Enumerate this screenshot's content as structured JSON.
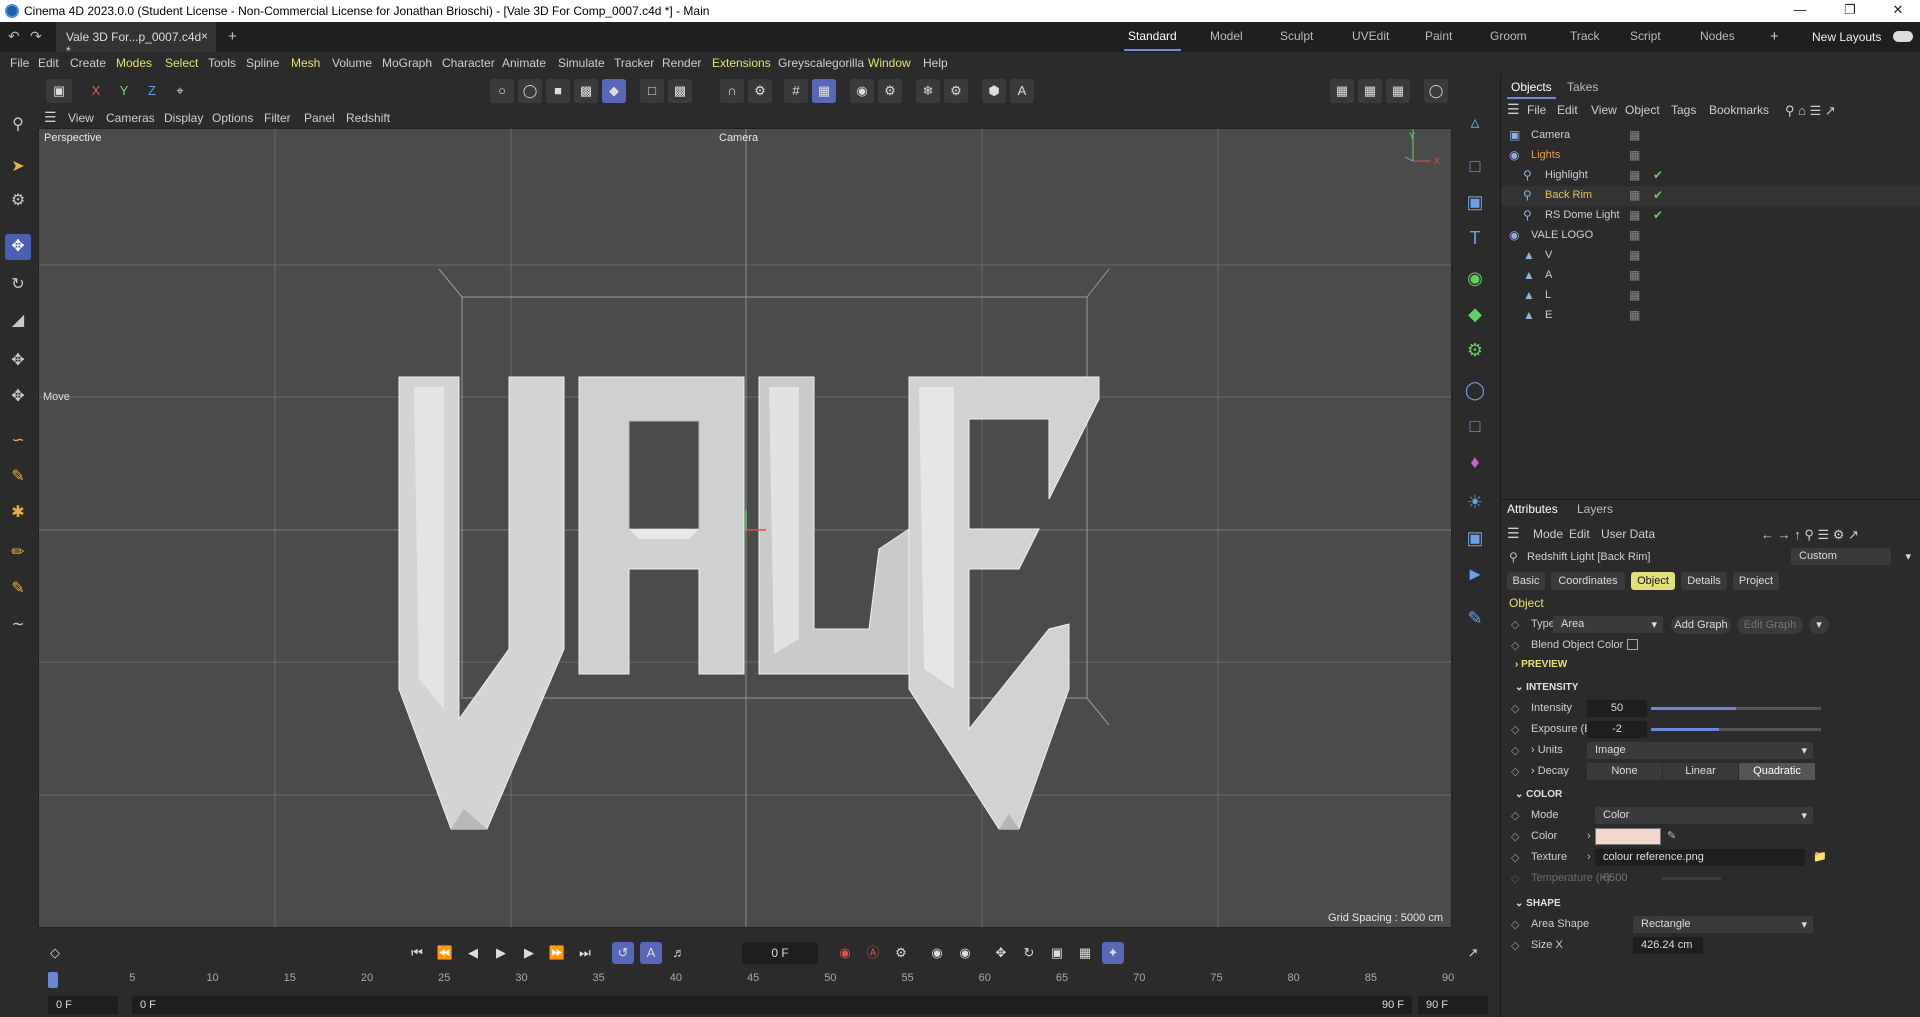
{
  "window": {
    "title": "Cinema 4D 2023.0.0 (Student License - Non-Commercial License for Jonathan Brioschi) - [Vale 3D For Comp_0007.c4d *] - Main"
  },
  "doc_tab": {
    "label": "Vale 3D For...p_0007.c4d *",
    "close": "×",
    "add": "+"
  },
  "layouts": [
    "Standard",
    "Model",
    "Sculpt",
    "UVEdit",
    "Paint",
    "Groom",
    "Track",
    "Script",
    "Nodes"
  ],
  "new_layouts": "New Layouts",
  "menu": [
    "File",
    "Edit",
    "Create",
    "Modes",
    "Select",
    "Tools",
    "Spline",
    "Mesh",
    "Volume",
    "MoGraph",
    "Character",
    "Animate",
    "Simulate",
    "Tracker",
    "Render",
    "Extensions",
    "Greyscalegorilla",
    "Window",
    "Help"
  ],
  "axes": [
    "X",
    "Y",
    "Z"
  ],
  "viewport_menu": [
    "View",
    "Cameras",
    "Display",
    "Options",
    "Filter",
    "Panel",
    "Redshift"
  ],
  "viewport": {
    "projection": "Perspective",
    "camera": "Camera",
    "grid_spacing": "Grid Spacing : 5000 cm",
    "tool_hint": "Move",
    "logo_text": "VALE"
  },
  "timeline": {
    "frame": "0 F",
    "start": "0 F",
    "start2": "0 F",
    "end": "90 F",
    "end2": "90 F",
    "ticks": [
      "0",
      "5",
      "10",
      "15",
      "20",
      "25",
      "30",
      "35",
      "40",
      "45",
      "50",
      "55",
      "60",
      "65",
      "70",
      "75",
      "80",
      "85",
      "90"
    ]
  },
  "objects_panel": {
    "tabs": [
      "Objects",
      "Takes"
    ],
    "menu": [
      "File",
      "Edit",
      "View",
      "Object",
      "Tags",
      "Bookmarks"
    ],
    "rows": [
      {
        "name": "Camera",
        "indent": 0,
        "color": "#cfcfcf"
      },
      {
        "name": "Lights",
        "indent": 0,
        "color": "#e0a050"
      },
      {
        "name": "Highlight",
        "indent": 1,
        "color": "#cfcfcf"
      },
      {
        "name": "Back Rim",
        "indent": 1,
        "color": "#e0c060"
      },
      {
        "name": "RS Dome Light",
        "indent": 1,
        "color": "#cfcfcf"
      },
      {
        "name": "VALE LOGO",
        "indent": 0,
        "color": "#cfcfcf"
      },
      {
        "name": "V",
        "indent": 1,
        "color": "#cfcfcf"
      },
      {
        "name": "A",
        "indent": 1,
        "color": "#cfcfcf"
      },
      {
        "name": "L",
        "indent": 1,
        "color": "#cfcfcf"
      },
      {
        "name": "E",
        "indent": 1,
        "color": "#cfcfcf"
      }
    ]
  },
  "attributes": {
    "tabs": [
      "Attributes",
      "Layers"
    ],
    "menu": [
      "Mode",
      "Edit",
      "User Data"
    ],
    "object_title": "Redshift Light [Back Rim]",
    "preset": "Custom",
    "subtabs": [
      "Basic",
      "Coordinates",
      "Object",
      "Details",
      "Project"
    ],
    "section_object": "Object",
    "type_label": "Type",
    "type_value": "Area",
    "add_graph": "Add Graph",
    "edit_graph": "Edit Graph",
    "blend_label": "Blend Object Color",
    "preview": "PREVIEW",
    "intensity_section": "INTENSITY",
    "intensity": {
      "label": "Intensity",
      "value": "50",
      "fraction": 0.5
    },
    "exposure": {
      "label": "Exposure (EV)",
      "value": "-2",
      "fraction": 0.4
    },
    "units": {
      "label": "Units",
      "value": "Image"
    },
    "decay": {
      "label": "Decay",
      "options": [
        "None",
        "Linear",
        "Quadratic"
      ]
    },
    "color_section": "COLOR",
    "mode": {
      "label": "Mode",
      "value": "Color"
    },
    "color": {
      "label": "Color",
      "swatch": "#f0d8cc"
    },
    "texture": {
      "label": "Texture",
      "value": "colour reference.png"
    },
    "temperature": {
      "label": "Temperature (K)",
      "value": "6500"
    },
    "shape_section": "SHAPE",
    "area_shape": {
      "label": "Area Shape",
      "value": "Rectangle"
    },
    "size_x": {
      "label": "Size X",
      "value": "426.24 cm"
    }
  }
}
